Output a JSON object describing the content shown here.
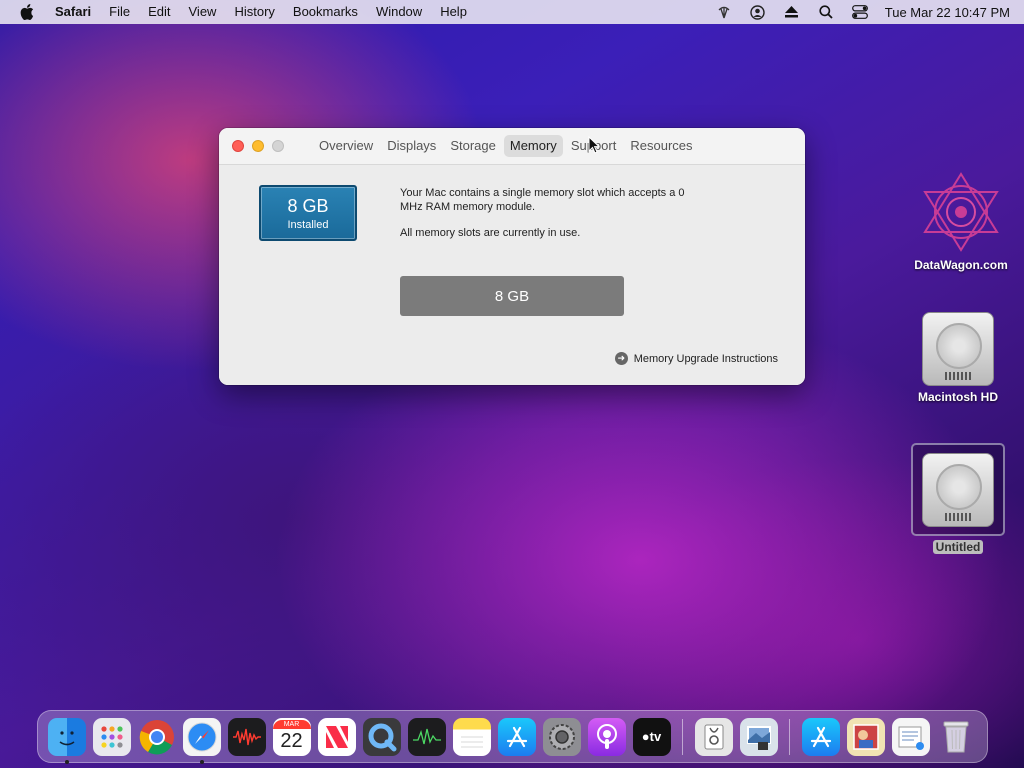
{
  "menubar": {
    "app_name": "Safari",
    "items": [
      "File",
      "Edit",
      "View",
      "History",
      "Bookmarks",
      "Window",
      "Help"
    ],
    "status_icons": [
      "wifi-icon",
      "user-icon",
      "eject-icon",
      "search-icon",
      "control-center-icon"
    ],
    "clock": "Tue Mar 22  10:47 PM"
  },
  "window": {
    "tabs": [
      {
        "label": "Overview",
        "active": false
      },
      {
        "label": "Displays",
        "active": false
      },
      {
        "label": "Storage",
        "active": false
      },
      {
        "label": "Memory",
        "active": true
      },
      {
        "label": "Support",
        "active": false
      },
      {
        "label": "Resources",
        "active": false
      }
    ],
    "badge": {
      "size": "8 GB",
      "caption": "Installed"
    },
    "description": {
      "line1": "Your Mac contains a single memory slot which accepts a 0 MHz RAM memory module.",
      "line2": "All memory slots are currently in use."
    },
    "slot_label": "8 GB",
    "upgrade_link": "Memory Upgrade Instructions"
  },
  "desktop_icons": [
    {
      "label": "DataWagon.com",
      "icon": "datawagon-logo-icon"
    },
    {
      "label": "Macintosh HD",
      "icon": "hard-disk-icon"
    },
    {
      "label": "Untitled",
      "icon": "hard-disk-icon",
      "selected": true
    }
  ],
  "dock": {
    "calendar_month": "MAR",
    "calendar_day": "22",
    "tv_label": "tv"
  }
}
